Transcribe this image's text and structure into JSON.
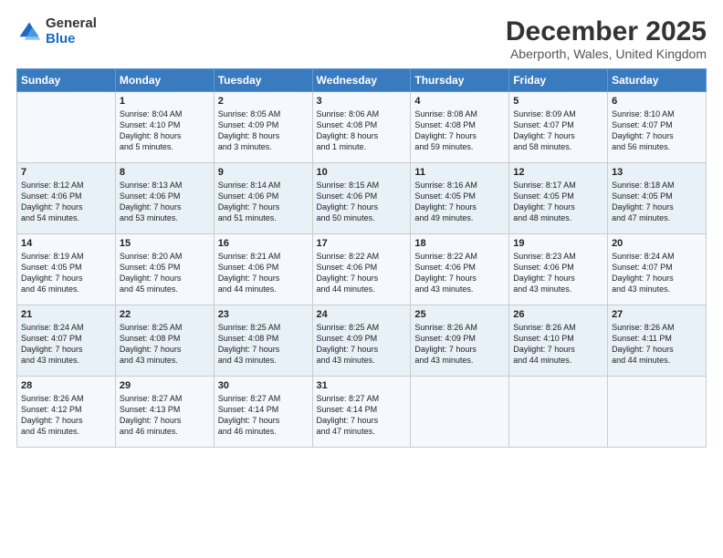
{
  "logo": {
    "general": "General",
    "blue": "Blue"
  },
  "title": "December 2025",
  "subtitle": "Aberporth, Wales, United Kingdom",
  "headers": [
    "Sunday",
    "Monday",
    "Tuesday",
    "Wednesday",
    "Thursday",
    "Friday",
    "Saturday"
  ],
  "weeks": [
    [
      {
        "day": "",
        "text": ""
      },
      {
        "day": "1",
        "text": "Sunrise: 8:04 AM\nSunset: 4:10 PM\nDaylight: 8 hours\nand 5 minutes."
      },
      {
        "day": "2",
        "text": "Sunrise: 8:05 AM\nSunset: 4:09 PM\nDaylight: 8 hours\nand 3 minutes."
      },
      {
        "day": "3",
        "text": "Sunrise: 8:06 AM\nSunset: 4:08 PM\nDaylight: 8 hours\nand 1 minute."
      },
      {
        "day": "4",
        "text": "Sunrise: 8:08 AM\nSunset: 4:08 PM\nDaylight: 7 hours\nand 59 minutes."
      },
      {
        "day": "5",
        "text": "Sunrise: 8:09 AM\nSunset: 4:07 PM\nDaylight: 7 hours\nand 58 minutes."
      },
      {
        "day": "6",
        "text": "Sunrise: 8:10 AM\nSunset: 4:07 PM\nDaylight: 7 hours\nand 56 minutes."
      }
    ],
    [
      {
        "day": "7",
        "text": "Sunrise: 8:12 AM\nSunset: 4:06 PM\nDaylight: 7 hours\nand 54 minutes."
      },
      {
        "day": "8",
        "text": "Sunrise: 8:13 AM\nSunset: 4:06 PM\nDaylight: 7 hours\nand 53 minutes."
      },
      {
        "day": "9",
        "text": "Sunrise: 8:14 AM\nSunset: 4:06 PM\nDaylight: 7 hours\nand 51 minutes."
      },
      {
        "day": "10",
        "text": "Sunrise: 8:15 AM\nSunset: 4:06 PM\nDaylight: 7 hours\nand 50 minutes."
      },
      {
        "day": "11",
        "text": "Sunrise: 8:16 AM\nSunset: 4:05 PM\nDaylight: 7 hours\nand 49 minutes."
      },
      {
        "day": "12",
        "text": "Sunrise: 8:17 AM\nSunset: 4:05 PM\nDaylight: 7 hours\nand 48 minutes."
      },
      {
        "day": "13",
        "text": "Sunrise: 8:18 AM\nSunset: 4:05 PM\nDaylight: 7 hours\nand 47 minutes."
      }
    ],
    [
      {
        "day": "14",
        "text": "Sunrise: 8:19 AM\nSunset: 4:05 PM\nDaylight: 7 hours\nand 46 minutes."
      },
      {
        "day": "15",
        "text": "Sunrise: 8:20 AM\nSunset: 4:05 PM\nDaylight: 7 hours\nand 45 minutes."
      },
      {
        "day": "16",
        "text": "Sunrise: 8:21 AM\nSunset: 4:06 PM\nDaylight: 7 hours\nand 44 minutes."
      },
      {
        "day": "17",
        "text": "Sunrise: 8:22 AM\nSunset: 4:06 PM\nDaylight: 7 hours\nand 44 minutes."
      },
      {
        "day": "18",
        "text": "Sunrise: 8:22 AM\nSunset: 4:06 PM\nDaylight: 7 hours\nand 43 minutes."
      },
      {
        "day": "19",
        "text": "Sunrise: 8:23 AM\nSunset: 4:06 PM\nDaylight: 7 hours\nand 43 minutes."
      },
      {
        "day": "20",
        "text": "Sunrise: 8:24 AM\nSunset: 4:07 PM\nDaylight: 7 hours\nand 43 minutes."
      }
    ],
    [
      {
        "day": "21",
        "text": "Sunrise: 8:24 AM\nSunset: 4:07 PM\nDaylight: 7 hours\nand 43 minutes."
      },
      {
        "day": "22",
        "text": "Sunrise: 8:25 AM\nSunset: 4:08 PM\nDaylight: 7 hours\nand 43 minutes."
      },
      {
        "day": "23",
        "text": "Sunrise: 8:25 AM\nSunset: 4:08 PM\nDaylight: 7 hours\nand 43 minutes."
      },
      {
        "day": "24",
        "text": "Sunrise: 8:25 AM\nSunset: 4:09 PM\nDaylight: 7 hours\nand 43 minutes."
      },
      {
        "day": "25",
        "text": "Sunrise: 8:26 AM\nSunset: 4:09 PM\nDaylight: 7 hours\nand 43 minutes."
      },
      {
        "day": "26",
        "text": "Sunrise: 8:26 AM\nSunset: 4:10 PM\nDaylight: 7 hours\nand 44 minutes."
      },
      {
        "day": "27",
        "text": "Sunrise: 8:26 AM\nSunset: 4:11 PM\nDaylight: 7 hours\nand 44 minutes."
      }
    ],
    [
      {
        "day": "28",
        "text": "Sunrise: 8:26 AM\nSunset: 4:12 PM\nDaylight: 7 hours\nand 45 minutes."
      },
      {
        "day": "29",
        "text": "Sunrise: 8:27 AM\nSunset: 4:13 PM\nDaylight: 7 hours\nand 46 minutes."
      },
      {
        "day": "30",
        "text": "Sunrise: 8:27 AM\nSunset: 4:14 PM\nDaylight: 7 hours\nand 46 minutes."
      },
      {
        "day": "31",
        "text": "Sunrise: 8:27 AM\nSunset: 4:14 PM\nDaylight: 7 hours\nand 47 minutes."
      },
      {
        "day": "",
        "text": ""
      },
      {
        "day": "",
        "text": ""
      },
      {
        "day": "",
        "text": ""
      }
    ]
  ]
}
